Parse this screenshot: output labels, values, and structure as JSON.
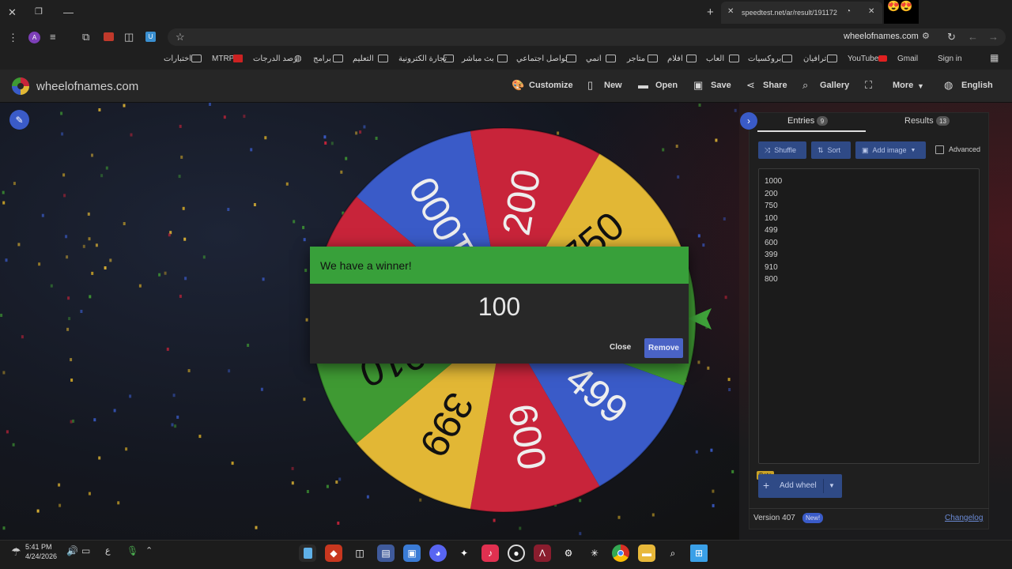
{
  "browser": {
    "tab_title": "speedtest.net/ar/result/191172",
    "url": "wheelofnames.com",
    "bookmarks": [
      "Sign in",
      "Gmail",
      "YouTube",
      "ترافيان",
      "بروكسيات",
      "العاب",
      "افلام",
      "متاجر",
      "انمي",
      "تواصل اجتماعي",
      "بث مباشر",
      "تجارة الكترونية",
      "التعليم",
      "برامج",
      "رصد الدرجات",
      "MTRP",
      "اختبارات"
    ]
  },
  "site": {
    "logo": "wheelofnames.com",
    "menu": [
      "Customize",
      "New",
      "Open",
      "Save",
      "Share",
      "Gallery",
      "More",
      "English"
    ]
  },
  "wheel": {
    "segments": [
      "1000",
      "200",
      "750",
      "100",
      "499",
      "600",
      "399",
      "910",
      "800"
    ],
    "colors": [
      "#3a5bc8",
      "#c8243a",
      "#e2b735",
      "#3f9a33",
      "#3a5bc8",
      "#c8243a",
      "#e2b735",
      "#3f9a33",
      "#c8243a"
    ]
  },
  "dialog": {
    "title": "We have a winner!",
    "winner": "100",
    "close": "Close",
    "remove": "Remove"
  },
  "panel": {
    "tab_entries": "Entries",
    "entries_count": "9",
    "tab_results": "Results",
    "results_count": "13",
    "shuffle": "Shuffle",
    "sort": "Sort",
    "add_image": "Add image",
    "advanced": "Advanced",
    "entries": [
      "1000",
      "200",
      "750",
      "100",
      "499",
      "600",
      "399",
      "910",
      "800"
    ],
    "beta": "Beta",
    "add_wheel": "Add wheel",
    "version": "Version 407",
    "new_badge": "New!",
    "changelog": "Changelog"
  },
  "taskbar": {
    "time": "5:41 PM",
    "date": "4/24/2026",
    "lang": "ع"
  },
  "colors": {
    "accent_green": "#38a03a",
    "button_blue": "#4a63c6",
    "panel_bg": "#1f1f1f"
  }
}
